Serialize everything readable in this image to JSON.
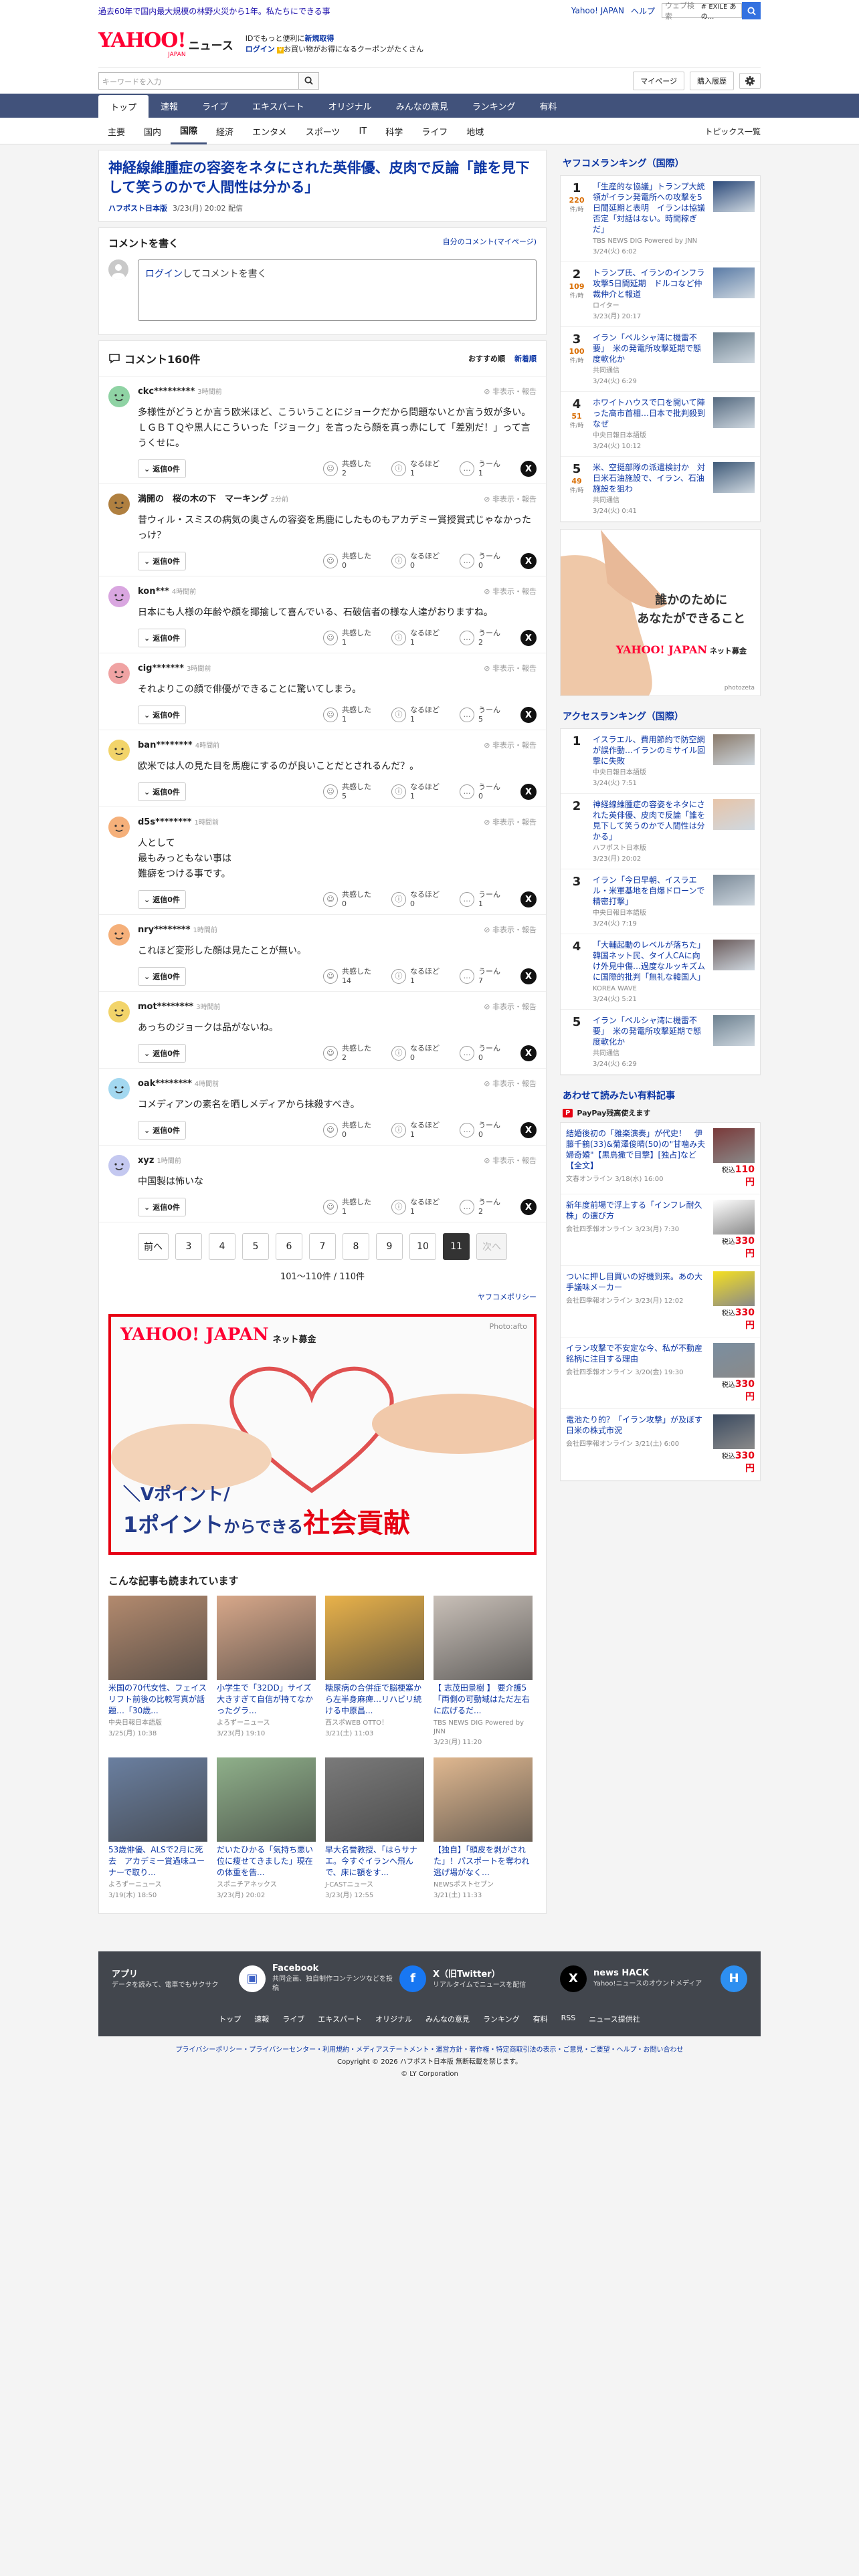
{
  "top_banner": {
    "notice": "過去60年で国内最大規模の林野火災から1年。私たちにできる事",
    "links": [
      "Yahoo! JAPAN",
      "ヘルプ"
    ],
    "search_placeholder": "ウェブ検索",
    "search_query": "# EXILE あの..."
  },
  "header": {
    "logo": "YAHOO!",
    "logo_sub": "JAPAN",
    "service": "ニュース",
    "info_line1_pre": "IDでもっと便利に",
    "info_line1_link": "新規取得",
    "info_line2_link": "ログイン",
    "info_line2_rest": "お買い物がお得になるクーポンがたくさん"
  },
  "subbar": {
    "keyword_placeholder": "キーワードを入力",
    "mypage": "マイページ",
    "history": "購入履歴"
  },
  "nav_tabs": [
    "トップ",
    "速報",
    "ライブ",
    "エキスパート",
    "オリジナル",
    "みんなの意見",
    "ランキング",
    "有料"
  ],
  "sub_nav": {
    "items": [
      "主要",
      "国内",
      "国際",
      "経済",
      "エンタメ",
      "スポーツ",
      "IT",
      "科学",
      "ライフ",
      "地域"
    ],
    "active": 2,
    "topics": "トピックス一覧"
  },
  "article": {
    "title": "神経線維腫症の容姿をネタにされた英俳優、皮肉で反論「誰を見下して笑うのかで人間性は分かる」",
    "publisher": "ハフポスト日本版",
    "date": "3/23(月) 20:02 配信"
  },
  "comment_write": {
    "heading": "コメントを書く",
    "my_comments": "自分のコメント(マイページ)",
    "box_link": "ログイン",
    "box_text": "してコメントを書く"
  },
  "comments_head": {
    "title": "コメント160件",
    "sort_recommended": "おすすめ順",
    "sort_new": "新着順"
  },
  "comment_labels": {
    "hide": "非表示・報告",
    "reply": "返信0件",
    "react_agree": "共感した",
    "react_insight": "なるほど",
    "react_hmm": "うーん"
  },
  "comments": [
    {
      "name": "ckc*********",
      "time": "3時間前",
      "text": "多様性がどうとか言う欧米ほど、こういうことにジョークだから問題ないとか言う奴が多い。ＬＧＢＴＱや黒人にこういった「ジョーク」を言ったら顔を真っ赤にして「差別だ！」って言うくせに。",
      "agree": "2",
      "insight": "1",
      "hmm": "1",
      "color": "#8fd3a4"
    },
    {
      "name": "満開の　桜の木の下　マーキング",
      "time": "2分前",
      "text": "昔ウィル・スミスの病気の奥さんの容姿を馬鹿にしたものもアカデミー賞授賞式じゃなかったっけ？",
      "agree": "0",
      "insight": "0",
      "hmm": "0",
      "color": "#b08040"
    },
    {
      "name": "kon***",
      "time": "4時間前",
      "text": "日本にも人様の年齢や顔を揶揄して喜んでいる、石破信者の様な人達がおりますね。",
      "agree": "1",
      "insight": "1",
      "hmm": "2",
      "color": "#d9a6e0"
    },
    {
      "name": "cig*******",
      "time": "3時間前",
      "text": "それよりこの顔で俳優ができることに驚いてしまう。",
      "agree": "1",
      "insight": "1",
      "hmm": "5",
      "color": "#f0a3a3"
    },
    {
      "name": "ban********",
      "time": "4時間前",
      "text": "欧米では人の見た目を馬鹿にするのが良いことだとされるんだ？。",
      "agree": "5",
      "insight": "1",
      "hmm": "0",
      "color": "#f2d46a"
    },
    {
      "name": "d5s********",
      "time": "1時間前",
      "text": "人として\n最もみっともない事は\n難癖をつける事です。",
      "agree": "0",
      "insight": "0",
      "hmm": "1",
      "color": "#f5b07a"
    },
    {
      "name": "nry********",
      "time": "1時間前",
      "text": "これほど変形した顔は見たことが無い。",
      "agree": "14",
      "insight": "1",
      "hmm": "7",
      "color": "#f5b07a"
    },
    {
      "name": "mot********",
      "time": "3時間前",
      "text": "あっちのジョークは品がないね。",
      "agree": "2",
      "insight": "0",
      "hmm": "0",
      "color": "#f2d46a"
    },
    {
      "name": "oak********",
      "time": "4時間前",
      "text": "コメディアンの素名を晒しメディアから抹殺すべき。",
      "agree": "0",
      "insight": "1",
      "hmm": "0",
      "color": "#a3d8f0"
    },
    {
      "name": "xyz",
      "time": "1時間前",
      "text": "中国製は怖いな",
      "agree": "1",
      "insight": "1",
      "hmm": "2",
      "color": "#c4c8f0"
    }
  ],
  "pager": {
    "prev": "前へ",
    "next": "次へ",
    "pages": [
      "3",
      "4",
      "5",
      "6",
      "7",
      "8",
      "9",
      "10",
      "11"
    ],
    "current": "11",
    "info": "101〜110件 / 110件",
    "policy": "ヤフコメポリシー"
  },
  "ad_big": {
    "logo": "YAHOO! JAPAN",
    "service": "ネット募金",
    "photo": "Photo:afto",
    "line1": "＼Vポイント/",
    "line2_a": "1ポイント",
    "line2_b": "からできる",
    "line2_c": "社会貢献"
  },
  "related": {
    "title": "こんな記事も読まれています",
    "items": [
      {
        "title": "米国の70代女性、フェイスリフト前後の比較写真が話題…「30歳...",
        "source": "中央日報日本語版",
        "date": "3/25(月) 10:38",
        "color": "#b38a6e"
      },
      {
        "title": "小学生で「32DD」サイズ　大きすぎて自信が持てなかったグラ...",
        "source": "よろずーニュース",
        "date": "3/23(月) 19:10",
        "color": "#d8a88a"
      },
      {
        "title": "糖尿病の合併症で脳梗塞から左半身麻痺…リハビリ続ける中原昌...",
        "source": "西スポWEB OTTO！",
        "date": "3/21(土) 11:03",
        "color": "#e9b24a"
      },
      {
        "title": "【 志茂田景樹 】 要介護5「両側の可動域はただ左右に広げるだ...",
        "source": "TBS NEWS DIG Powered by JNN",
        "date": "3/23(月) 11:20",
        "color": "#c9c0b8"
      },
      {
        "title": "53歳俳優、ALSで2月に死去　アカデミー賞過味ユーナーで取り...",
        "source": "よろずーニュース",
        "date": "3/19(木) 18:50",
        "color": "#6a7fa0"
      },
      {
        "title": "だいたひかる「気持ち悪い位に痩せてきました」現在の体重を告...",
        "source": "スポニチアネックス",
        "date": "3/23(月) 20:02",
        "color": "#8fb08a"
      },
      {
        "title": "早大名誉教授、「はらサナエ。今すぐイランへ飛んで、床に額をす...",
        "source": "J-CASTニュース",
        "date": "3/23(月) 12:55",
        "color": "#7a7a7a"
      },
      {
        "title": "【独自】「頭皮を剥がされた」！パスポートを奪われ逃げ場がなく…",
        "source": "NEWSポストセブン",
        "date": "3/21(土) 11:33",
        "color": "#e0b890"
      }
    ]
  },
  "ranking_comments": {
    "title": "ヤフコメランキング（国際）",
    "unit": "件/時",
    "items": [
      {
        "n": "1",
        "c": "220",
        "title": "「生産的な協議」トランプ大統領がイラン発電所への攻撃を5日間延期と表明　イランは協議否定「対話はない。時間稼ぎだ」",
        "source": "TBS NEWS DIG Powered by JNN",
        "date": "3/24(火) 6:02",
        "color": "#2c4a7a"
      },
      {
        "n": "2",
        "c": "109",
        "title": "トランプ氏、イランのインフラ攻撃5日間延期　ドルコなど仲裁仲介と報道",
        "source": "ロイター",
        "date": "3/23(月) 20:17",
        "color": "#5a7ba6"
      },
      {
        "n": "3",
        "c": "100",
        "title": "イラン「ペルシャ湾に機雷不要」　米の発電所攻撃延期で態度軟化か",
        "source": "共同通信",
        "date": "3/24(火) 6:29",
        "color": "#6d8190"
      },
      {
        "n": "4",
        "c": "51",
        "title": "ホワイトハウスで口を開いて陣った高市首相…日本で批判殺到なぜ",
        "source": "中央日報日本語版",
        "date": "3/24(火) 10:12",
        "color": "#556a80"
      },
      {
        "n": "5",
        "c": "49",
        "title": "米、空挺部隊の派遣検討か　対日米石油施設で、イラン、石油施設を狙わ",
        "source": "共同通信",
        "date": "3/24(火) 0:41",
        "color": "#3f5a78"
      }
    ]
  },
  "ad_right": {
    "line1": "誰かのために",
    "line2": "あなたができること",
    "logo": "YAHOO! JAPAN",
    "service": "ネット募金",
    "credit": "photozeta"
  },
  "ranking_access": {
    "title": "アクセスランキング（国際）",
    "items": [
      {
        "n": "1",
        "title": "イスラエル、費用節約で防空網が誤作動…イランのミサイル回撃に失敗",
        "source": "中央日報日本語版",
        "date": "3/24(火) 7:51",
        "color": "#8a7a6a"
      },
      {
        "n": "2",
        "title": "神経線維腫症の容姿をネタにされた英俳優、皮肉で反論「誰を見下して笑うのかで人間性は分かる」",
        "source": "ハフポスト日本版",
        "date": "3/23(月) 20:02",
        "color": "#e7c4a8"
      },
      {
        "n": "3",
        "title": "イラン「今日早朝、イスラエル・米軍基地を自爆ドローンで精密打撃」",
        "source": "中央日報日本語版",
        "date": "3/24(火) 7:19",
        "color": "#7b8a98"
      },
      {
        "n": "4",
        "title": "「大輔起動のレベルが落ちた」韓国ネット民、タイ人CAに向け外見中傷…過度なルッキズムに国際的批判「無礼な韓国人」",
        "source": "KOREA WAVE",
        "date": "3/24(火) 5:21",
        "color": "#6a5a5a"
      },
      {
        "n": "5",
        "title": "イラン「ペルシャ湾に機雷不要」　米の発電所攻撃延期で態度軟化か",
        "source": "共同通信",
        "date": "3/24(火) 6:29",
        "color": "#6d8190"
      }
    ]
  },
  "paid": {
    "title": "あわせて読みたい有料記事",
    "pp_logo": "P",
    "pp_text": "PayPay残高使えます",
    "price_pre": "税込",
    "items": [
      {
        "title": "結婚後初の「雅楽演奏」が代史！　伊藤千鶴(33)&菊澤俊晴(50)の\"甘噛み夫婦奇婚\"【黒鳥撒で目撃】[独占]など【全文】",
        "source": "文春オンライン",
        "date": "3/18(水) 16:00",
        "price": "110円",
        "color": "#7a3a3a"
      },
      {
        "title": "新年度前場で浮上する「インフレ耐久株」の選び方",
        "source": "会社四季報オンライン",
        "date": "3/23(月) 7:30",
        "price": "330円",
        "color": "#ffffff"
      },
      {
        "title": "ついに押し目買いの好機到来。あの大手議味メーカー",
        "source": "会社四季報オンライン",
        "date": "3/23(月) 12:02",
        "price": "330円",
        "color": "#f5e020"
      },
      {
        "title": "イラン攻撃で不安定な今、私が不動産銘柄に注目する理由",
        "source": "会社四季報オンライン",
        "date": "3/20(金) 19:30",
        "price": "330円",
        "color": "#7a8ea0"
      },
      {
        "title": "電池たり的？「イラン攻撃」が及ぼす日米の株式市況",
        "source": "会社四季報オンライン",
        "date": "3/21(土) 6:00",
        "price": "330円",
        "color": "#3a4a60"
      }
    ]
  },
  "footer": {
    "cols": [
      {
        "t": "アプリ",
        "d": "データを読みて、電車でもサクサク",
        "icon": "app-icon",
        "bg": "#ffffff",
        "fg": "#3a5fc4",
        "glyph": "▣"
      },
      {
        "t": "Facebook",
        "d": "共同企画、独自制作コンテンツなどを投稿",
        "icon": "facebook-icon",
        "bg": "#1877f2",
        "fg": "#ffffff",
        "glyph": "f"
      },
      {
        "t": "X（旧Twitter）",
        "d": "リアルタイムでニュースを配信",
        "icon": "x-icon",
        "bg": "#000000",
        "fg": "#ffffff",
        "glyph": "X"
      },
      {
        "t": "news HACK",
        "d": "Yahoo!ニュースのオウンドメディア",
        "icon": "news-hack-icon",
        "bg": "#2d8ff0",
        "fg": "#ffffff",
        "glyph": "H"
      }
    ],
    "nav": [
      "トップ",
      "速報",
      "ライブ",
      "エキスパート",
      "オリジナル",
      "みんなの意見",
      "ランキング",
      "有料",
      "RSS",
      "ニュース提供社"
    ],
    "legal_links": "プライバシーポリシー・プライバシーセンター・利用規約・メディアステートメント・運営方針・著作権・特定商取引法の表示・ご意見・ご要望・ヘルプ・お問い合わせ",
    "copyright": "Copyright © 2026 ハフポスト日本版 無断転載を禁じます。",
    "corp": "© LY Corporation"
  }
}
